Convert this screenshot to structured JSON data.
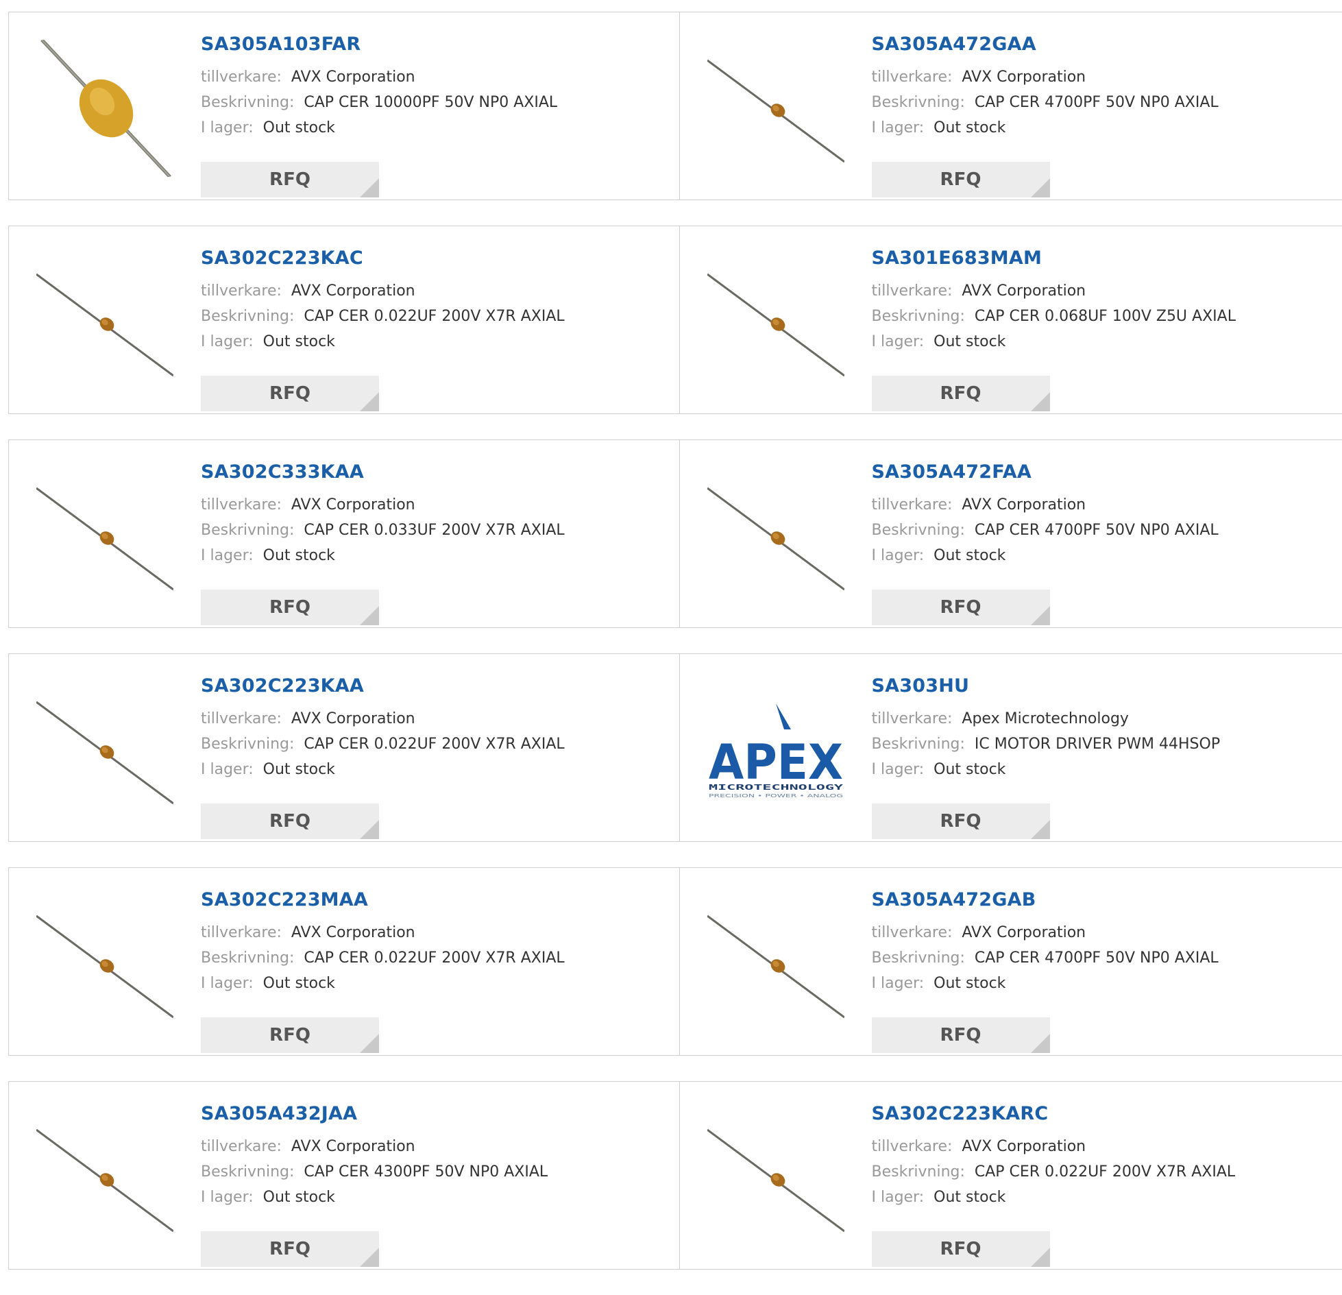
{
  "labels": {
    "manufacturer": "tillverkare:",
    "description": "Beskrivning:",
    "stock": "I lager:",
    "rfq": "RFQ"
  },
  "products": [
    {
      "part": "SA305A103FAR",
      "manufacturer": "AVX Corporation",
      "description": "CAP CER 10000PF 50V NP0 AXIAL",
      "stock": "Out stock",
      "image": "large-yellow-axial-capacitor"
    },
    {
      "part": "SA305A472GAA",
      "manufacturer": "AVX Corporation",
      "description": "CAP CER 4700PF 50V NP0 AXIAL",
      "stock": "Out stock",
      "image": "small-axial-capacitor"
    },
    {
      "part": "SA302C223KAC",
      "manufacturer": "AVX Corporation",
      "description": "CAP CER 0.022UF 200V X7R AXIAL",
      "stock": "Out stock",
      "image": "small-axial-capacitor"
    },
    {
      "part": "SA301E683MAM",
      "manufacturer": "AVX Corporation",
      "description": "CAP CER 0.068UF 100V Z5U AXIAL",
      "stock": "Out stock",
      "image": "small-axial-capacitor"
    },
    {
      "part": "SA302C333KAA",
      "manufacturer": "AVX Corporation",
      "description": "CAP CER 0.033UF 200V X7R AXIAL",
      "stock": "Out stock",
      "image": "small-axial-capacitor"
    },
    {
      "part": "SA305A472FAA",
      "manufacturer": "AVX Corporation",
      "description": "CAP CER 4700PF 50V NP0 AXIAL",
      "stock": "Out stock",
      "image": "small-axial-capacitor"
    },
    {
      "part": "SA302C223KAA",
      "manufacturer": "AVX Corporation",
      "description": "CAP CER 0.022UF 200V X7R AXIAL",
      "stock": "Out stock",
      "image": "small-axial-capacitor"
    },
    {
      "part": "SA303HU",
      "manufacturer": "Apex Microtechnology",
      "description": "IC MOTOR DRIVER PWM 44HSOP",
      "stock": "Out stock",
      "image": "apex-logo",
      "logo": {
        "word": "APEX",
        "line1": "MICROTECHNOLOGY",
        "line2": "PRECISION • POWER • ANALOG"
      }
    },
    {
      "part": "SA302C223MAA",
      "manufacturer": "AVX Corporation",
      "description": "CAP CER 0.022UF 200V X7R AXIAL",
      "stock": "Out stock",
      "image": "small-axial-capacitor"
    },
    {
      "part": "SA305A472GAB",
      "manufacturer": "AVX Corporation",
      "description": "CAP CER 4700PF 50V NP0 AXIAL",
      "stock": "Out stock",
      "image": "small-axial-capacitor"
    },
    {
      "part": "SA305A432JAA",
      "manufacturer": "AVX Corporation",
      "description": "CAP CER 4300PF 50V NP0 AXIAL",
      "stock": "Out stock",
      "image": "small-axial-capacitor"
    },
    {
      "part": "SA302C223KARC",
      "manufacturer": "AVX Corporation",
      "description": "CAP CER 0.022UF 200V X7R AXIAL",
      "stock": "Out stock",
      "image": "small-axial-capacitor"
    }
  ],
  "colors": {
    "part_link": "#1a5fa8",
    "label": "#999999",
    "value": "#333333",
    "rfq_bg": "#ececec",
    "apex_blue": "#1b5aa6"
  }
}
